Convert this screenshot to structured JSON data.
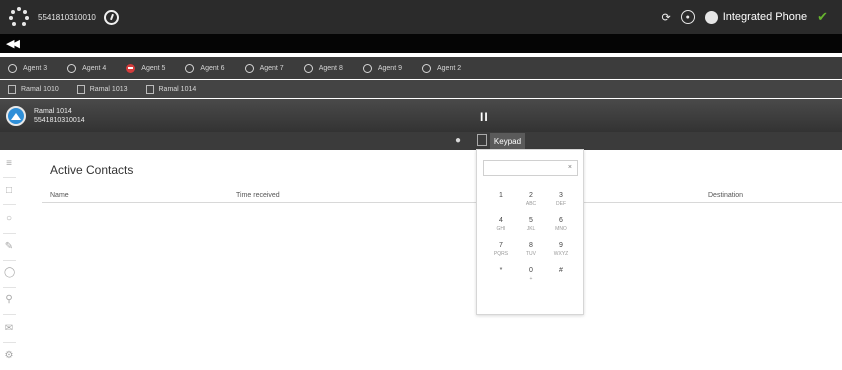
{
  "header": {
    "phone_number": "5541810310010",
    "integrated_phone_label": "Integrated Phone"
  },
  "agents": [
    {
      "label": "Agent 3",
      "status": "ring"
    },
    {
      "label": "Agent 4",
      "status": "ring"
    },
    {
      "label": "Agent 5",
      "status": "dnd"
    },
    {
      "label": "Agent 6",
      "status": "ring"
    },
    {
      "label": "Agent 7",
      "status": "ring"
    },
    {
      "label": "Agent 8",
      "status": "ring"
    },
    {
      "label": "Agent 9",
      "status": "ring"
    },
    {
      "label": "Agent 2",
      "status": "ring"
    }
  ],
  "ramais": [
    {
      "label": "Ramal 1010"
    },
    {
      "label": "Ramal 1013"
    },
    {
      "label": "Ramal 1014"
    }
  ],
  "call": {
    "name": "Ramal 1014",
    "number": "5541810310014",
    "pause_symbol": "II"
  },
  "toolbar": {
    "keypad_label": "Keypad"
  },
  "main": {
    "title": "Active Contacts",
    "columns": {
      "name": "Name",
      "time_received": "Time received",
      "destination": "Destination"
    }
  },
  "keypad": {
    "clear_symbol": "×",
    "keys": [
      {
        "digit": "1",
        "letters": ""
      },
      {
        "digit": "2",
        "letters": "ABC"
      },
      {
        "digit": "3",
        "letters": "DEF"
      },
      {
        "digit": "4",
        "letters": "GHI"
      },
      {
        "digit": "5",
        "letters": "JKL"
      },
      {
        "digit": "6",
        "letters": "MNO"
      },
      {
        "digit": "7",
        "letters": "PQRS"
      },
      {
        "digit": "8",
        "letters": "TUV"
      },
      {
        "digit": "9",
        "letters": "WXYZ"
      },
      {
        "digit": "*",
        "letters": ""
      },
      {
        "digit": "0",
        "letters": "+"
      },
      {
        "digit": "#",
        "letters": ""
      }
    ]
  },
  "sidebar": {
    "icons": [
      "list-icon",
      "document-icon",
      "contacts-icon",
      "edit-icon",
      "history-icon",
      "search-icon",
      "mail-icon",
      "settings-icon"
    ]
  },
  "colors": {
    "header_bg": "#2b2b2b",
    "phone_green": "#66b32e",
    "dnd_red": "#d33b3b",
    "avatar_blue": "#2f8fd8"
  }
}
